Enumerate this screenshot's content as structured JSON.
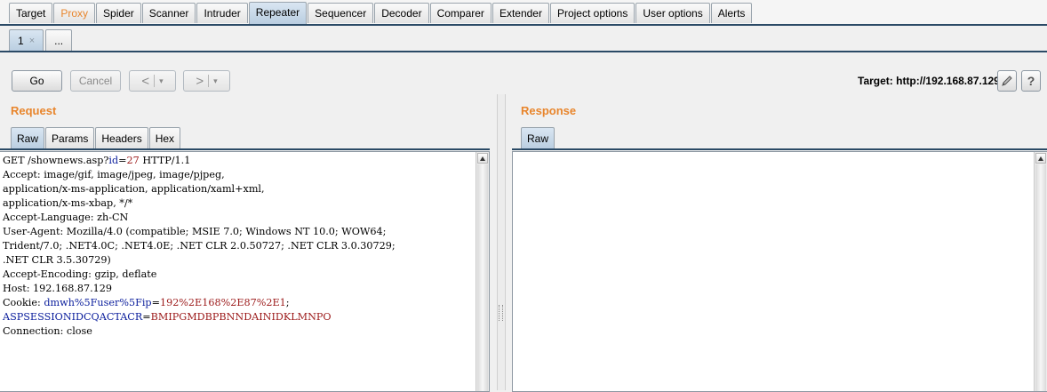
{
  "tool_tabs": [
    {
      "label": "Target"
    },
    {
      "label": "Proxy",
      "highlight": true
    },
    {
      "label": "Spider"
    },
    {
      "label": "Scanner"
    },
    {
      "label": "Intruder"
    },
    {
      "label": "Repeater",
      "active": true
    },
    {
      "label": "Sequencer"
    },
    {
      "label": "Decoder"
    },
    {
      "label": "Comparer"
    },
    {
      "label": "Extender"
    },
    {
      "label": "Project options"
    },
    {
      "label": "User options"
    },
    {
      "label": "Alerts"
    }
  ],
  "repeater_tabs": {
    "first": "1",
    "close": "×",
    "more": "..."
  },
  "toolbar": {
    "go": "Go",
    "cancel": "Cancel",
    "back_glyph": "<",
    "forward_glyph": ">",
    "dropdown_glyph": "▾",
    "target_label": "Target: http://192.168.87.129",
    "help_glyph": "?"
  },
  "request": {
    "title": "Request",
    "tabs": [
      "Raw",
      "Params",
      "Headers",
      "Hex"
    ],
    "lines": [
      {
        "segments": [
          {
            "t": "GET /shownews.asp?"
          },
          {
            "t": "id",
            "c": "k"
          },
          {
            "t": "="
          },
          {
            "t": "27",
            "c": "v"
          },
          {
            "t": " HTTP/1.1"
          }
        ]
      },
      {
        "segments": [
          {
            "t": "Accept: image/gif, image/jpeg, image/pjpeg,"
          }
        ]
      },
      {
        "segments": [
          {
            "t": "application/x-ms-application, application/xaml+xml,"
          }
        ]
      },
      {
        "segments": [
          {
            "t": "application/x-ms-xbap, */*"
          }
        ]
      },
      {
        "segments": [
          {
            "t": "Accept-Language: zh-CN"
          }
        ]
      },
      {
        "segments": [
          {
            "t": "User-Agent: Mozilla/4.0 (compatible; MSIE 7.0; Windows NT 10.0; WOW64;"
          }
        ]
      },
      {
        "segments": [
          {
            "t": "Trident/7.0; .NET4.0C; .NET4.0E; .NET CLR 2.0.50727; .NET CLR 3.0.30729;"
          }
        ]
      },
      {
        "segments": [
          {
            "t": ".NET CLR 3.5.30729)"
          }
        ]
      },
      {
        "segments": [
          {
            "t": "Accept-Encoding: gzip, deflate"
          }
        ]
      },
      {
        "segments": [
          {
            "t": "Host: 192.168.87.129"
          }
        ]
      },
      {
        "segments": [
          {
            "t": "Cookie: "
          },
          {
            "t": "dmwh%5Fuser%5Fip",
            "c": "k"
          },
          {
            "t": "="
          },
          {
            "t": "192%2E168%2E87%2E1",
            "c": "v"
          },
          {
            "t": ";"
          }
        ]
      },
      {
        "segments": [
          {
            "t": "ASPSESSIONIDCQACTACR",
            "c": "k"
          },
          {
            "t": "="
          },
          {
            "t": "BMIPGMDBPBNNDAINIDKLMNPO",
            "c": "v"
          }
        ]
      },
      {
        "segments": [
          {
            "t": "Connection: close"
          }
        ]
      }
    ]
  },
  "response": {
    "title": "Response",
    "tabs": [
      "Raw"
    ]
  },
  "colors": {
    "accent_orange": "#e8852c",
    "tab_active": "#b9cde0",
    "dark_line": "#2b4a66",
    "param_name": "#0a1d9c",
    "param_value": "#9c1a1a"
  }
}
